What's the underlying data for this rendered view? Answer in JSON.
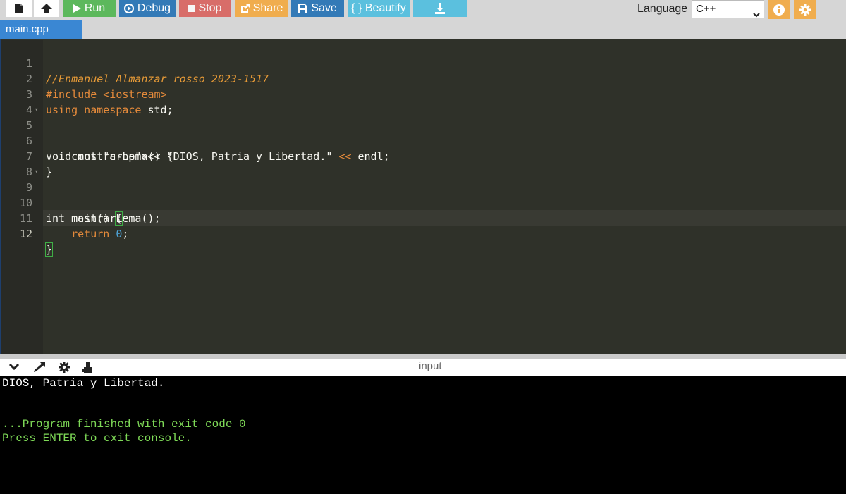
{
  "toolbar": {
    "run_label": "Run",
    "debug_label": "Debug",
    "stop_label": "Stop",
    "share_label": "Share",
    "save_label": "Save",
    "beautify_label": "{ } Beautify",
    "language_label": "Language",
    "language_value": "C++",
    "icons": [
      "new-file-icon",
      "upload-icon",
      "play-icon",
      "debug-icon",
      "stop-icon",
      "share-icon",
      "save-icon",
      "download-icon",
      "info-icon",
      "gear-icon"
    ],
    "colors": {
      "run": "#5cb85c",
      "debug": "#337ab7",
      "stop": "#d9534f",
      "share": "#f0ad4e",
      "save": "#337ab7",
      "beautify": "#5bc0de",
      "download": "#5bc0de",
      "info": "#f0ad4e",
      "settings": "#f0ad4e"
    }
  },
  "tabs": [
    {
      "label": "main.cpp"
    }
  ],
  "editor": {
    "line_numbers": [
      "1",
      "2",
      "3",
      "4",
      "5",
      "6",
      "7",
      "8",
      "9",
      "10",
      "11",
      "12"
    ],
    "lines": [
      "//Enmanuel Almanzar rosso_2023-1517",
      "#include <iostream>",
      "using namespace std;",
      "",
      "void mostrarLema() {",
      "    cout << \"DIOS, Patria y Libertad.\" << endl;",
      "}",
      "",
      "int main() {",
      "    mostrarLema();",
      "    return 0;",
      "}"
    ]
  },
  "console": {
    "title": "input",
    "icons": [
      "chevron-down-icon",
      "expand-icon",
      "gear-icon",
      "terminal-icon"
    ],
    "output": [
      "DIOS, Patria y Libertad.",
      "",
      "",
      "...Program finished with exit code 0",
      "Press ENTER to exit console."
    ],
    "colors": {
      "program_output": "#ffffff",
      "system_message": "#7ed957"
    }
  }
}
